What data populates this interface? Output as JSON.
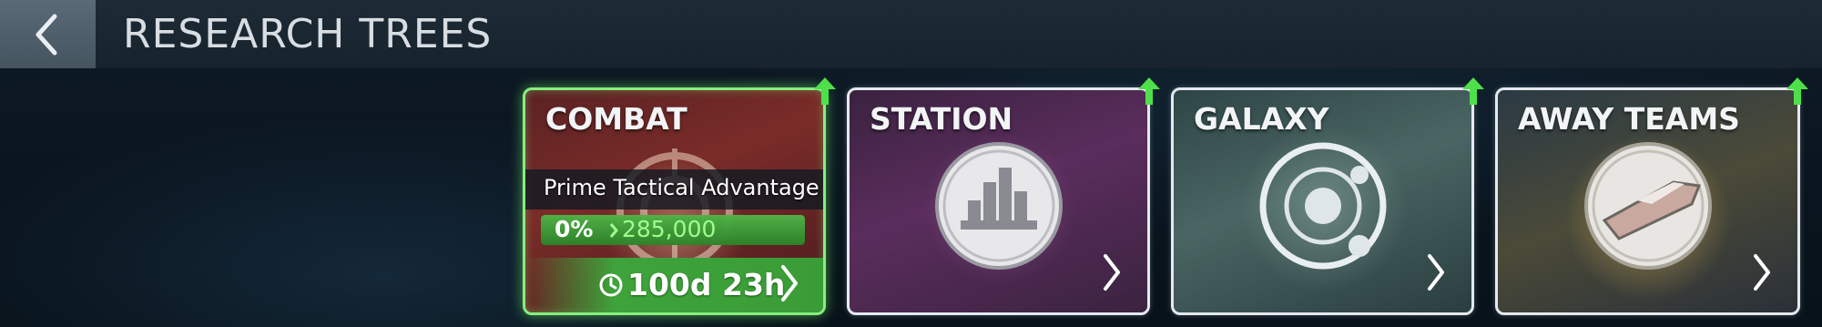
{
  "header": {
    "title": "RESEARCH TREES",
    "back_icon": "chevron-left-icon"
  },
  "cards": [
    {
      "title": "COMBAT",
      "emblem_icon": "crosshair-icon",
      "state": "researching",
      "has_upgrade": true,
      "active_research": {
        "name": "Prime Tactical Advantage",
        "progress_label": "0%",
        "progress": 0,
        "cost": "285,000",
        "time_remaining": "100d 23h"
      },
      "accent_color": "#86ee7e"
    },
    {
      "title": "STATION",
      "emblem_icon": "city-buildings-icon",
      "has_upgrade": true
    },
    {
      "title": "GALAXY",
      "emblem_icon": "planet-orbit-icon",
      "has_upgrade": true
    },
    {
      "title": "AWAY TEAMS",
      "emblem_icon": "shuttle-icon",
      "has_upgrade": true
    }
  ],
  "colors": {
    "upgrade_green": "#4ee04a",
    "progress_green": "#3ea33a",
    "cost_text": "#9dff8e"
  }
}
